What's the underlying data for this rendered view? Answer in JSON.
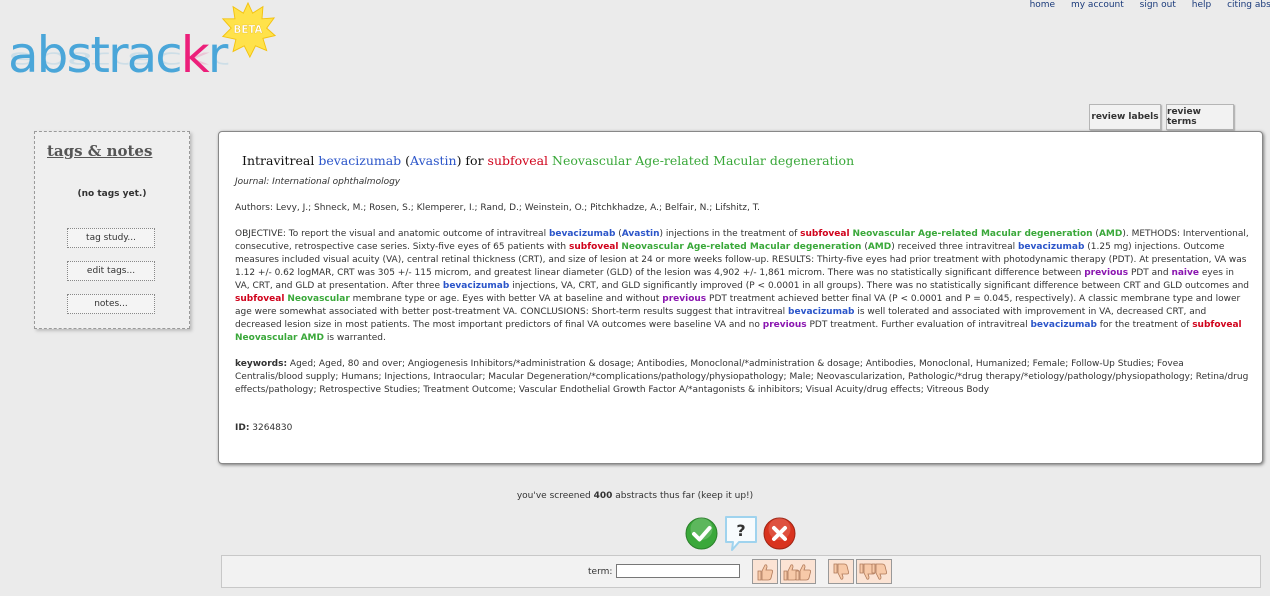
{
  "nav": {
    "home": "home",
    "my_account": "my account",
    "sign_out": "sign out",
    "help": "help",
    "citing": "citing abstr"
  },
  "logo": {
    "text_main": "abstrac",
    "text_k": "k",
    "text_r": "r",
    "badge": "BETA"
  },
  "review": {
    "labels": "review labels",
    "terms": "review terms"
  },
  "tags_panel": {
    "title": "tags & notes",
    "empty": "(no tags yet.)",
    "tag_study": "tag study...",
    "edit_tags": "edit tags...",
    "notes": "notes..."
  },
  "abstract": {
    "title": {
      "p1": "Intravitreal ",
      "p2": "bevacizumab",
      "p3": " (",
      "p4": "Avastin",
      "p5": ") for ",
      "p6": "subfoveal",
      "p7": " Neovascular Age-related Macular degeneration"
    },
    "journal": "Journal: International ophthalmology",
    "authors": "Authors: Levy, J.; Shneck, M.; Rosen, S.; Klemperer, I.; Rand, D.; Weinstein, O.; Pitchkhadze, A.; Belfair, N.; Lifshitz, T.",
    "body": [
      {
        "t": "OBJECTIVE: To report the visual and anatomic outcome of intravitreal ",
        "c": ""
      },
      {
        "t": "bevacizumab",
        "c": "blue"
      },
      {
        "t": " (",
        "c": ""
      },
      {
        "t": "Avastin",
        "c": "blue"
      },
      {
        "t": ") injections in the treatment of ",
        "c": ""
      },
      {
        "t": "subfoveal",
        "c": "red"
      },
      {
        "t": " ",
        "c": ""
      },
      {
        "t": "Neovascular Age-related Macular degeneration",
        "c": "green"
      },
      {
        "t": " (",
        "c": ""
      },
      {
        "t": "AMD",
        "c": "green"
      },
      {
        "t": "). METHODS: Interventional, consecutive, retrospective case series. Sixty-five eyes of 65 patients with ",
        "c": ""
      },
      {
        "t": "subfoveal",
        "c": "red"
      },
      {
        "t": " ",
        "c": ""
      },
      {
        "t": "Neovascular Age-related Macular degeneration",
        "c": "green"
      },
      {
        "t": " (",
        "c": ""
      },
      {
        "t": "AMD",
        "c": "green"
      },
      {
        "t": ") received three intravitreal ",
        "c": ""
      },
      {
        "t": "bevacizumab",
        "c": "blue"
      },
      {
        "t": " (1.25 mg) injections. Outcome measures included visual acuity (VA), central retinal thickness (CRT), and size of lesion at 24 or more weeks follow-up. RESULTS: Thirty-five eyes had prior treatment with photodynamic therapy (PDT). At presentation, VA was 1.12 +/- 0.62 logMAR, CRT was 305 +/- 115 microm, and greatest linear diameter (GLD) of the lesion was 4,902 +/- 1,861 microm. There was no statistically significant difference between ",
        "c": ""
      },
      {
        "t": "previous",
        "c": "purple"
      },
      {
        "t": " PDT and ",
        "c": ""
      },
      {
        "t": "naive",
        "c": "purple"
      },
      {
        "t": " eyes in VA, CRT, and GLD at presentation. After three ",
        "c": ""
      },
      {
        "t": "bevacizumab",
        "c": "blue"
      },
      {
        "t": " injections, VA, CRT, and GLD significantly improved (P < 0.0001 in all groups). There was no statistically significant difference between CRT and GLD outcomes and ",
        "c": ""
      },
      {
        "t": "subfoveal",
        "c": "red"
      },
      {
        "t": " ",
        "c": ""
      },
      {
        "t": "Neovascular",
        "c": "green"
      },
      {
        "t": " membrane type or age. Eyes with better VA at baseline and without ",
        "c": ""
      },
      {
        "t": "previous",
        "c": "purple"
      },
      {
        "t": " PDT treatment achieved better final VA (P < 0.0001 and P = 0.045, respectively). A classic membrane type and lower age were somewhat associated with better post-treatment VA. CONCLUSIONS: Short-term results suggest that intravitreal ",
        "c": ""
      },
      {
        "t": "bevacizumab",
        "c": "blue"
      },
      {
        "t": " is well tolerated and associated with improvement in VA, decreased CRT, and decreased lesion size in most patients. The most important predictors of final VA outcomes were baseline VA and no ",
        "c": ""
      },
      {
        "t": "previous",
        "c": "purple"
      },
      {
        "t": " PDT treatment. Further evaluation of intravitreal ",
        "c": ""
      },
      {
        "t": "bevacizumab",
        "c": "blue"
      },
      {
        "t": " for the treatment of ",
        "c": ""
      },
      {
        "t": "subfoveal",
        "c": "red"
      },
      {
        "t": " ",
        "c": ""
      },
      {
        "t": "Neovascular AMD",
        "c": "green"
      },
      {
        "t": " is warranted.",
        "c": ""
      }
    ],
    "keywords_label": "keywords:",
    "keywords": " Aged; Aged, 80 and over; Angiogenesis Inhibitors/*administration & dosage; Antibodies, Monoclonal/*administration & dosage; Antibodies, Monoclonal, Humanized; Female; Follow-Up Studies; Fovea Centralis/blood supply; Humans; Injections, Intraocular; Macular Degeneration/*complications/pathology/physiopathology; Male; Neovascularization, Pathologic/*drug therapy/*etiology/pathology/physiopathology; Retina/drug effects/pathology; Retrospective Studies; Treatment Outcome; Vascular Endothelial Growth Factor A/*antagonists & inhibitors; Visual Acuity/drug effects; Vitreous Body",
    "id_label": "ID:",
    "id_value": " 3264830"
  },
  "progress": {
    "pre": "you've screened ",
    "count": "400",
    "post": " abstracts thus far (keep it up!)"
  },
  "term_bar": {
    "label": "term:",
    "value": ""
  },
  "colors": {
    "accept": "#3aa83a",
    "reject": "#d9331e",
    "maybe": "#9fd3ee",
    "logo_blue": "#4aa6d9",
    "logo_pink": "#ec1f7a"
  }
}
